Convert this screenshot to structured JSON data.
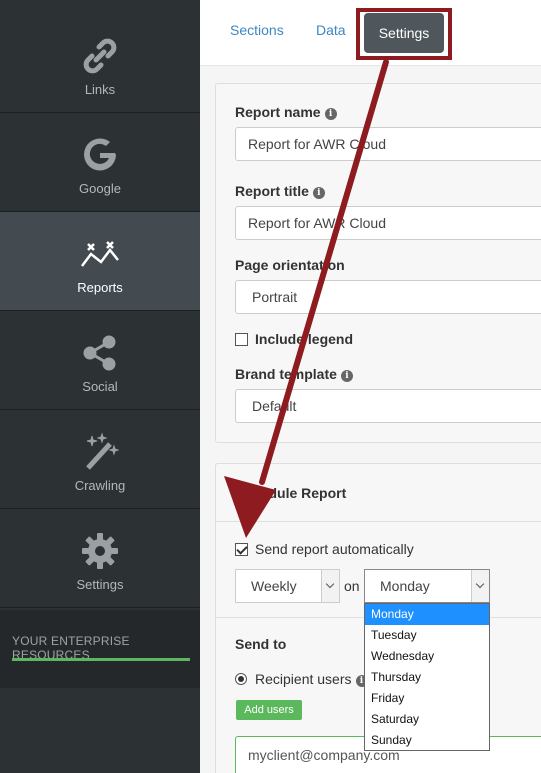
{
  "sidebar": {
    "items": [
      {
        "label": "Links",
        "icon": "link-icon"
      },
      {
        "label": "Google",
        "icon": "google-icon"
      },
      {
        "label": "Reports",
        "icon": "reports-icon"
      },
      {
        "label": "Social",
        "icon": "share-icon"
      },
      {
        "label": "Crawling",
        "icon": "magic-wand-icon"
      },
      {
        "label": "Settings",
        "icon": "gear-icon"
      }
    ],
    "enterprise": "YOUR ENTERPRISE RESOURCES"
  },
  "tabs": {
    "sections": "Sections",
    "data": "Data",
    "settings": "Settings"
  },
  "report": {
    "name_label": "Report name",
    "name_value": "Report for AWR Cloud",
    "title_label": "Report title",
    "title_value": "Report for AWR Cloud",
    "orientation_label": "Page orientation",
    "orientation_value": "Portrait",
    "legend_label": "Include legend",
    "template_label": "Brand template",
    "template_value": "Default"
  },
  "schedule": {
    "title": "Schedule Report",
    "auto_label": "Send report automatically",
    "frequency": "Weekly",
    "on_label": "on",
    "day": "Monday",
    "day_options": [
      "Monday",
      "Tuesday",
      "Wednesday",
      "Thursday",
      "Friday",
      "Saturday",
      "Sunday"
    ],
    "send_to_label": "Send to",
    "recipient_label": "Recipient users",
    "add_users": "Add users",
    "email": "myclient@company.com"
  },
  "colors": {
    "annotation": "#8e1b1f",
    "accent": "#3a87c6",
    "success": "#5cb85c"
  }
}
